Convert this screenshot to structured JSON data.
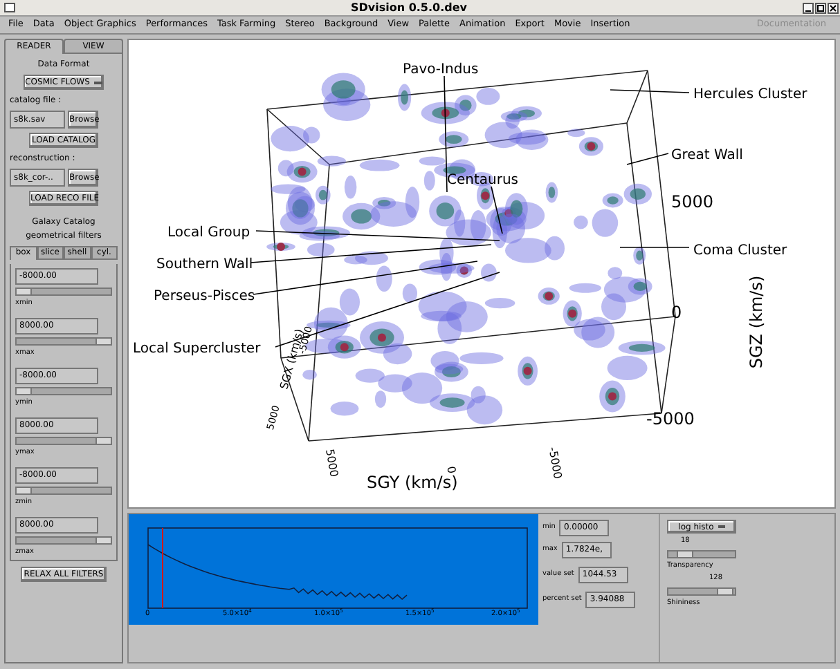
{
  "window": {
    "title": "SDvision 0.5.0.dev"
  },
  "menu": [
    {
      "label": "File",
      "disabled": false
    },
    {
      "label": "Data",
      "disabled": false
    },
    {
      "label": "Object Graphics",
      "disabled": false
    },
    {
      "label": "Performances",
      "disabled": false
    },
    {
      "label": "Task Farming",
      "disabled": false
    },
    {
      "label": "Stereo",
      "disabled": false
    },
    {
      "label": "Background",
      "disabled": false
    },
    {
      "label": "View",
      "disabled": false
    },
    {
      "label": "Palette",
      "disabled": false
    },
    {
      "label": "Animation",
      "disabled": false
    },
    {
      "label": "Export",
      "disabled": false
    },
    {
      "label": "Movie",
      "disabled": false
    },
    {
      "label": "Insertion",
      "disabled": false
    },
    {
      "label": "Documentation",
      "disabled": true
    }
  ],
  "tabs": [
    {
      "label": "READER",
      "selected": true
    },
    {
      "label": "VIEW",
      "selected": false
    }
  ],
  "reader": {
    "data_format_label": "Data Format",
    "data_format": "COSMIC FLOWS",
    "catalog_label": "catalog file :",
    "catalog_file": "s8k.sav",
    "browse_1": "Browse",
    "load_catalog": "LOAD CATALOG",
    "reconstruction_label": "reconstruction :",
    "reconstruction_file": "s8k_cor-..",
    "browse_2": "Browse",
    "load_reco": "LOAD RECO FILE",
    "catalog_title": "Galaxy Catalog",
    "filters_title": "geometrical filters",
    "filter_tabs": [
      {
        "label": "box",
        "selected": true
      },
      {
        "label": "slice",
        "selected": false
      },
      {
        "label": "shell",
        "selected": false
      },
      {
        "label": "cyl.",
        "selected": false
      }
    ],
    "filter_fields": [
      "-8000.00",
      "8000.00",
      "-8000.00",
      "8000.00",
      "-8000.00",
      "8000.00"
    ],
    "filter_sliders": [
      {
        "level": 0.08,
        "label": "xmin"
      },
      {
        "level": 0.92,
        "label": "xmax"
      },
      {
        "level": 0.08,
        "label": "ymin"
      },
      {
        "level": 0.92,
        "label": "ymax"
      },
      {
        "level": 0.08,
        "label": "zmin"
      },
      {
        "level": 0.92,
        "label": "zmax"
      }
    ],
    "relax_button": "RELAX ALL FILTERS"
  },
  "scene": {
    "labels": [
      "Pavo-Indus",
      "Hercules Cluster",
      "Great Wall",
      "Centaurus",
      "Local Group",
      "Coma Cluster",
      "Southern Wall",
      "Perseus-Pisces",
      "Local Supercluster"
    ],
    "z_axis": "SGZ (km/s)",
    "z_ticks": [
      "5000",
      "0",
      "-5000"
    ],
    "y_axis": "SGY (km/s)",
    "y_ticks": [
      "5000",
      "0",
      "-5000"
    ],
    "x_axis": "SGX (km/s)",
    "x_ticks": [
      "5000",
      "-5000"
    ]
  },
  "histogram": {
    "x_tick_labels": [
      "0",
      "5.0×10$^{4}$",
      "1.0×10$^{5}$",
      "1.5×10$^{5}$",
      "2.0×10$^{5}$"
    ],
    "marker": {
      "level": 0.035
    }
  },
  "stats": [
    {
      "label": "min",
      "value": "0.00000"
    },
    {
      "label": "max",
      "value": "1.7824e,"
    },
    {
      "label": "value set",
      "value": "1044.53"
    },
    {
      "label": "percent set",
      "value": "3.94088"
    }
  ],
  "render": {
    "mode": "log histo",
    "transparency": {
      "value": "18",
      "level": 0.25,
      "label": "Transparency"
    },
    "shininess": {
      "value": "128",
      "level": 0.85,
      "label": "Shininess"
    }
  }
}
